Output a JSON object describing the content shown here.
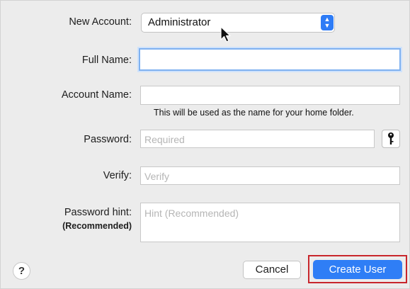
{
  "form": {
    "new_account_label": "New Account:",
    "new_account_value": "Administrator",
    "full_name_label": "Full Name:",
    "full_name_value": "",
    "account_name_label": "Account Name:",
    "account_name_value": "",
    "account_name_note": "This will be used as the name for your home folder.",
    "password_label": "Password:",
    "password_placeholder": "Required",
    "verify_label": "Verify:",
    "verify_placeholder": "Verify",
    "hint_label": "Password hint:",
    "hint_sublabel": "(Recommended)",
    "hint_placeholder": "Hint (Recommended)"
  },
  "buttons": {
    "help": "?",
    "cancel": "Cancel",
    "create_user": "Create User"
  },
  "colors": {
    "accent": "#2f7ef6",
    "highlight_outline": "#c8262c",
    "focus_ring": "#7fb1f0"
  },
  "icons": [
    "chevron-updown-icon",
    "key-icon",
    "help-icon",
    "mouse-cursor-icon"
  ]
}
